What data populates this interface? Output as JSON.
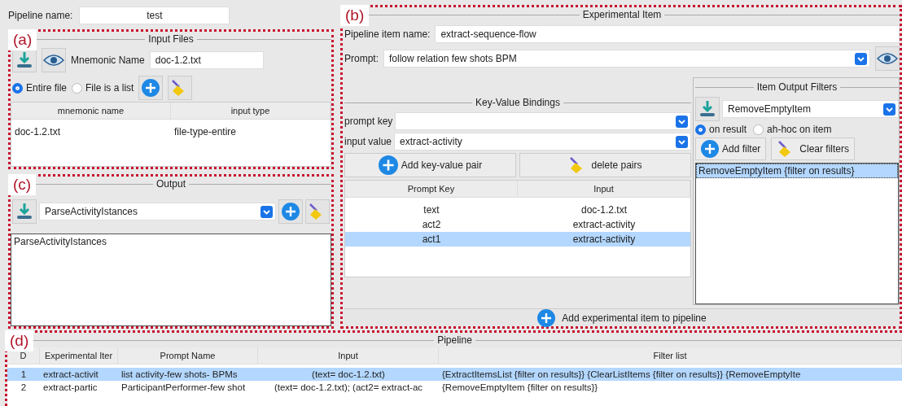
{
  "pipeline_name": {
    "label": "Pipeline name:",
    "value": "test"
  },
  "input_files": {
    "tag": "(a)",
    "title": "Input Files",
    "mnemonic_label": "Mnemonic Name",
    "mnemonic_value": "doc-1.2.txt",
    "options": [
      {
        "label": "Entire file",
        "selected": true
      },
      {
        "label": "File is a list",
        "selected": false
      }
    ],
    "columns": [
      "mnemonic name",
      "input type"
    ],
    "rows": [
      [
        "doc-1.2.txt",
        "file-type-entire"
      ]
    ]
  },
  "output": {
    "tag": "(c)",
    "title": "Output",
    "selected_value": "ParseActivityIstances",
    "list": [
      "ParseActivityIstances"
    ]
  },
  "experimental_item": {
    "tag": "(b)",
    "title": "Experimental Item",
    "name_label": "Pipeline item name:",
    "name_value": "extract-sequence-flow",
    "prompt_label": "Prompt:",
    "prompt_value": "follow relation few shots BPM",
    "bindings": {
      "title": "Key-Value Bindings",
      "prompt_key_label": "prompt key",
      "input_value_label": "input value",
      "input_value": "extract-activity",
      "add_button": "Add key-value pair",
      "delete_button": "delete pairs",
      "columns": [
        "Prompt Key",
        "Input"
      ],
      "rows": [
        {
          "key": "text",
          "input": "doc-1.2.txt",
          "selected": false
        },
        {
          "key": "act2",
          "input": "extract-activity",
          "selected": false
        },
        {
          "key": "act1",
          "input": "extract-activity",
          "selected": true
        }
      ]
    },
    "filters": {
      "title": "Item Output Filters",
      "selected_value": "RemoveEmptyItem",
      "options": [
        {
          "label": "on result",
          "selected": true
        },
        {
          "label": "ah-hoc on item",
          "selected": false
        }
      ],
      "add_button": "Add filter",
      "clear_button": "Clear filters",
      "list": [
        {
          "text": "RemoveEmptyItem {filter on results}",
          "selected": true
        }
      ]
    },
    "add_button": "Add experimental item to pipeline"
  },
  "pipeline": {
    "tag": "(d)",
    "title": "Pipeline",
    "columns": [
      "D",
      "Experimental Iter",
      "Prompt Name",
      "Input",
      "Filter list"
    ],
    "rows": [
      {
        "cells": [
          "1",
          "extract-activit",
          "list activity-few shots- BPMs",
          "(text= doc-1.2.txt)",
          "{ExtractItemsList {filter on results}} {ClearListItems {filter on results}} {RemoveEmptyIte"
        ],
        "selected": true
      },
      {
        "cells": [
          "2",
          "extract-partic",
          "ParticipantPerformer-few shot",
          "(text= doc-1.2.txt); (act2= extract-ac",
          "{RemoveEmptyItem {filter on results}}"
        ],
        "selected": false
      }
    ]
  }
}
